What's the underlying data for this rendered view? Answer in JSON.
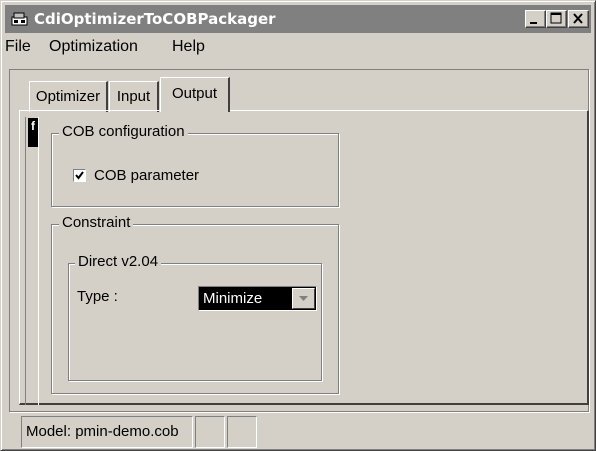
{
  "window": {
    "title": "CdiOptimizerToCOBPackager",
    "app_icon": "app-icon",
    "controls": {
      "minimize": "minimize-icon",
      "maximize": "maximize-icon",
      "close": "close-icon"
    }
  },
  "menubar": {
    "items": [
      "File",
      "Optimization",
      "Help"
    ]
  },
  "tabs": [
    {
      "label": "Optimizer",
      "active": false
    },
    {
      "label": "Input",
      "active": false
    },
    {
      "label": "Output",
      "active": true
    }
  ],
  "side_tab": {
    "label": "f"
  },
  "cob_configuration": {
    "title": "COB configuration",
    "checkbox": {
      "label": "COB parameter",
      "checked": true
    }
  },
  "constraint": {
    "title": "Constraint",
    "direct": {
      "title": "Direct v2.04",
      "type_label": "Type :",
      "type_value": "Minimize"
    }
  },
  "statusbar": {
    "model_text": "Model: pmin-demo.cob"
  },
  "colors": {
    "face": "#d4d0c8",
    "titlebar": "#808080",
    "highlight": "#ffffff",
    "shadow": "#808080"
  }
}
